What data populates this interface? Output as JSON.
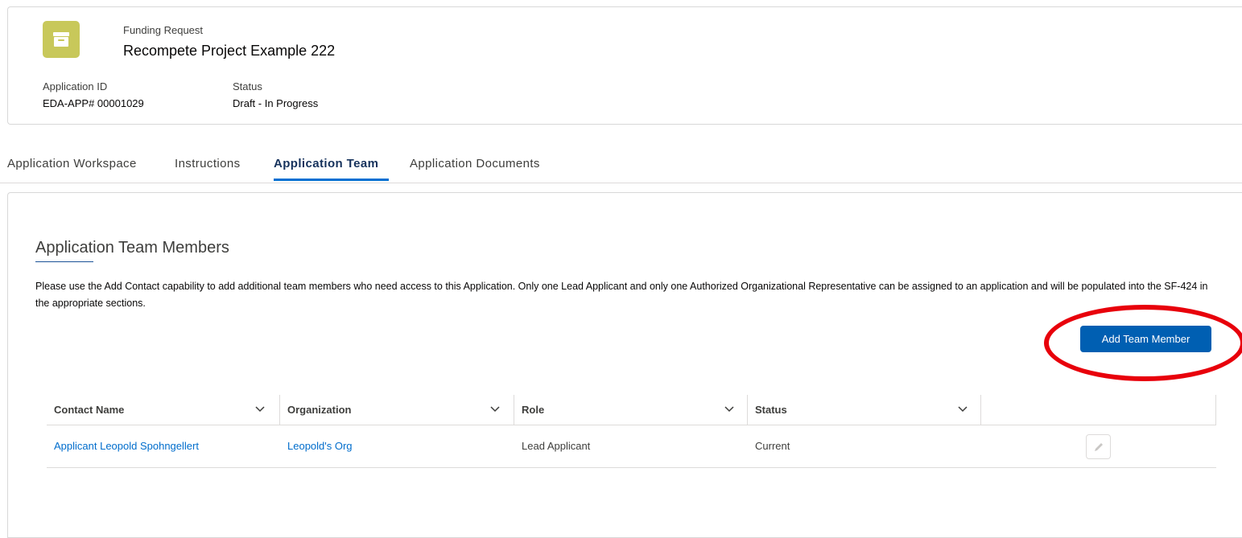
{
  "record": {
    "object_label": "Funding Request",
    "title": "Recompete Project Example 222",
    "fields": [
      {
        "label": "Application ID",
        "value": "EDA-APP# 00001029"
      },
      {
        "label": "Status",
        "value": "Draft - In Progress"
      }
    ],
    "icon": "archive-box-icon",
    "icon_color": "#c8c85a"
  },
  "tabs": [
    {
      "label": "Application Workspace",
      "active": false
    },
    {
      "label": "Instructions",
      "active": false
    },
    {
      "label": "Application Team",
      "active": true
    },
    {
      "label": "Application Documents",
      "active": false
    }
  ],
  "team_section": {
    "title": "Application Team Members",
    "instructions": "Please use the Add Contact capability to add additional team members who need access to this Application. Only one Lead Applicant and only one Authorized Organizational Representative can be assigned to an application and will be populated into the SF-424 in the appropriate sections.",
    "add_button_label": "Add Team Member",
    "table": {
      "columns": [
        "Contact Name",
        "Organization",
        "Role",
        "Status"
      ],
      "rows": [
        {
          "contact_name": "Applicant Leopold Spohngellert",
          "organization": "Leopold's Org",
          "role": "Lead Applicant",
          "status": "Current"
        }
      ]
    }
  },
  "colors": {
    "brand_button": "#005fb2",
    "active_tab_underline": "#0070d2",
    "link": "#006dcc",
    "annotation_circle": "#e8000b"
  }
}
